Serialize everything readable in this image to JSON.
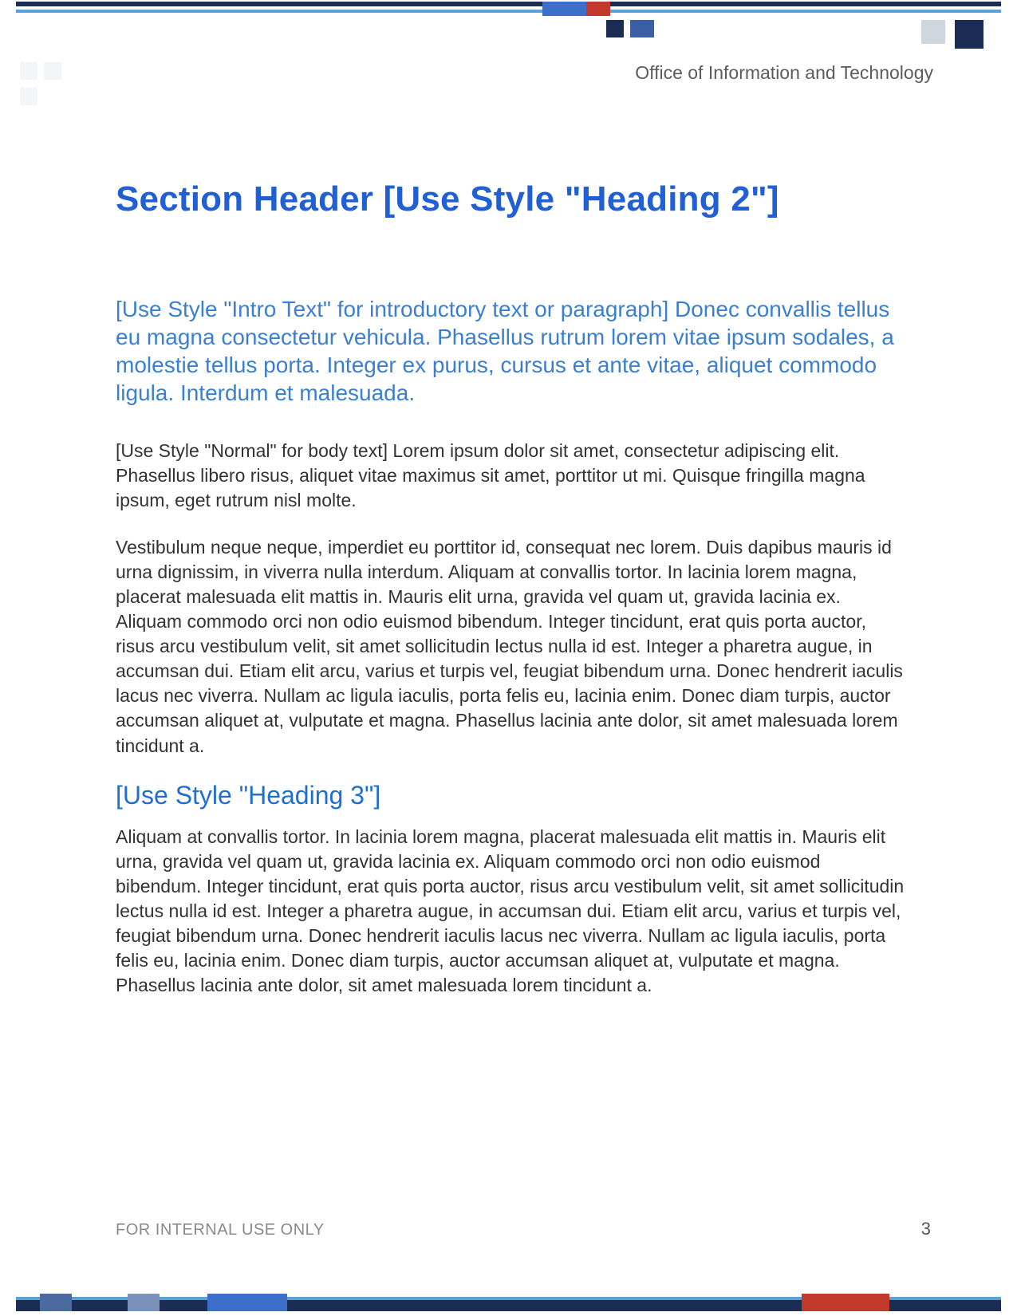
{
  "header": {
    "org": "Office of Information and Technology"
  },
  "colors": {
    "heading_blue": "#205fd4",
    "intro_blue": "#3b7fd0",
    "navy": "#1b2c55",
    "accent_blue": "#3b6fc9",
    "red": "#c0392b",
    "light_blue_bar": "#5aa1d8"
  },
  "content": {
    "h2": "Section Header [Use Style \"Heading 2\"]",
    "intro": "[Use Style \"Intro Text\" for introductory text or paragraph] Donec convallis tellus eu magna consectetur vehicula. Phasellus rutrum lorem vitae ipsum sodales, a molestie tellus porta. Integer ex purus, cursus et ante vitae, aliquet commodo ligula. Interdum et malesuada.",
    "body1": "[Use Style \"Normal\" for body text] Lorem ipsum dolor sit amet, consectetur adipiscing elit. Phasellus libero risus, aliquet vitae maximus sit amet, porttitor ut mi. Quisque fringilla magna ipsum, eget rutrum nisl molte.",
    "body2": "Vestibulum neque neque, imperdiet eu porttitor id, consequat nec lorem. Duis dapibus mauris id urna dignissim, in viverra nulla interdum. Aliquam at convallis tortor. In lacinia lorem magna, placerat malesuada elit mattis in. Mauris elit urna, gravida vel quam ut, gravida lacinia ex. Aliquam commodo orci non odio euismod bibendum. Integer tincidunt, erat quis porta auctor, risus arcu vestibulum velit, sit amet sollicitudin lectus nulla id est. Integer a pharetra augue, in accumsan dui. Etiam elit arcu, varius et turpis vel, feugiat bibendum urna. Donec hendrerit iaculis lacus nec viverra. Nullam ac ligula iaculis, porta felis eu, lacinia enim. Donec diam turpis, auctor accumsan aliquet at, vulputate et magna. Phasellus lacinia ante dolor, sit amet malesuada lorem tincidunt a.",
    "h3": "[Use Style \"Heading 3\"]",
    "body3": "Aliquam at convallis tortor. In lacinia lorem magna, placerat malesuada elit mattis in. Mauris elit urna, gravida vel quam ut, gravida lacinia ex. Aliquam commodo orci non odio euismod bibendum. Integer tincidunt, erat quis porta auctor, risus arcu vestibulum velit, sit amet sollicitudin lectus nulla id est. Integer a pharetra augue, in accumsan dui. Etiam elit arcu, varius et turpis vel, feugiat bibendum urna. Donec hendrerit iaculis lacus nec viverra. Nullam ac ligula iaculis, porta felis eu, lacinia enim. Donec diam turpis, auctor accumsan aliquet at, vulputate et magna. Phasellus lacinia ante dolor, sit amet malesuada lorem tincidunt a."
  },
  "footer": {
    "classification": "FOR INTERNAL USE ONLY",
    "page_number": "3"
  }
}
